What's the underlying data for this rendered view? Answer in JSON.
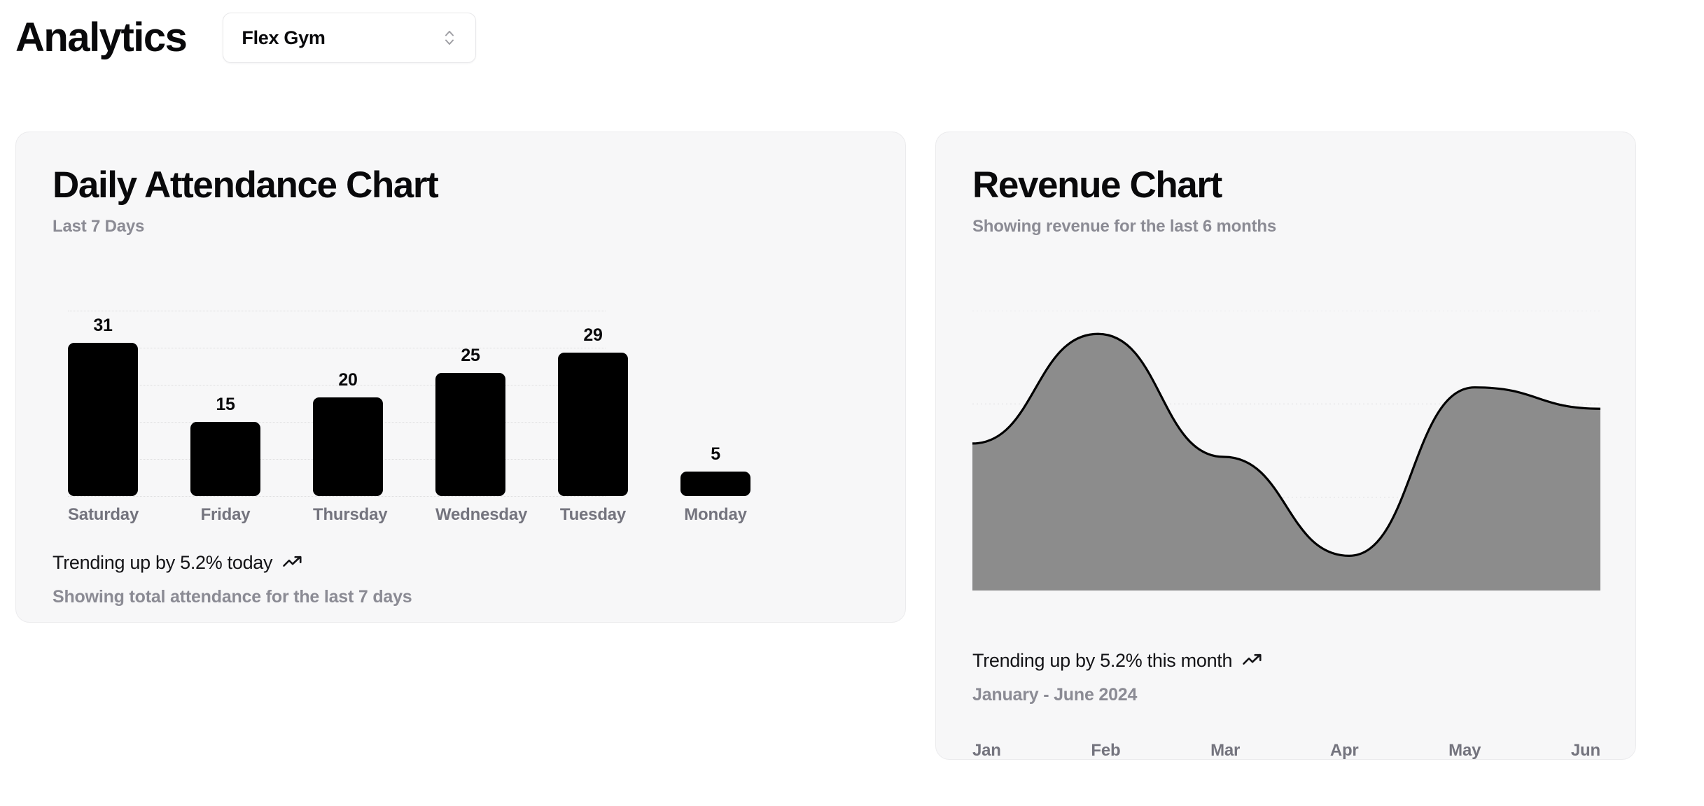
{
  "header": {
    "title": "Analytics",
    "gym_select": {
      "value": "Flex Gym",
      "chevron_icon": "chevron-up-down-icon"
    }
  },
  "attendance_card": {
    "title": "Daily Attendance Chart",
    "subtitle": "Last 7 Days",
    "trend_text": "Trending up by 5.2% today",
    "trend_icon": "trending-up-icon",
    "note": "Showing total attendance for the last 7 days"
  },
  "revenue_card": {
    "title": "Revenue Chart",
    "subtitle": "Showing revenue for the last 6 months",
    "trend_text": "Trending up by 5.2% this month",
    "trend_icon": "trending-up-icon",
    "note": "January - June 2024"
  },
  "colors": {
    "bar_fill": "#000000",
    "area_fill": "#8c8c8c",
    "area_stroke": "#000000",
    "card_bg": "#f7f7f8",
    "card_border": "#ebebed",
    "muted_text": "#74747e",
    "title_text": "#09090b"
  },
  "chart_data": [
    {
      "type": "bar",
      "title": "Daily Attendance Chart",
      "subtitle": "Last 7 Days",
      "categories": [
        "Saturday",
        "Friday",
        "Thursday",
        "Wednesday",
        "Tuesday",
        "Monday"
      ],
      "values": [
        31,
        15,
        20,
        25,
        29,
        5
      ],
      "xlabel": "",
      "ylabel": "",
      "ylim": [
        0,
        35
      ],
      "grid": true,
      "legend": "none",
      "data_labels": true
    },
    {
      "type": "area",
      "title": "Revenue Chart",
      "subtitle": "Showing revenue for the last 6 months",
      "categories": [
        "Jan",
        "Feb",
        "Mar",
        "Apr",
        "May",
        "Jun"
      ],
      "values": [
        55,
        96,
        50,
        13,
        76,
        68
      ],
      "xlabel": "",
      "ylabel": "",
      "ylim": [
        0,
        100
      ],
      "grid": true,
      "legend": "none",
      "data_labels": false,
      "curve": "smooth"
    }
  ]
}
